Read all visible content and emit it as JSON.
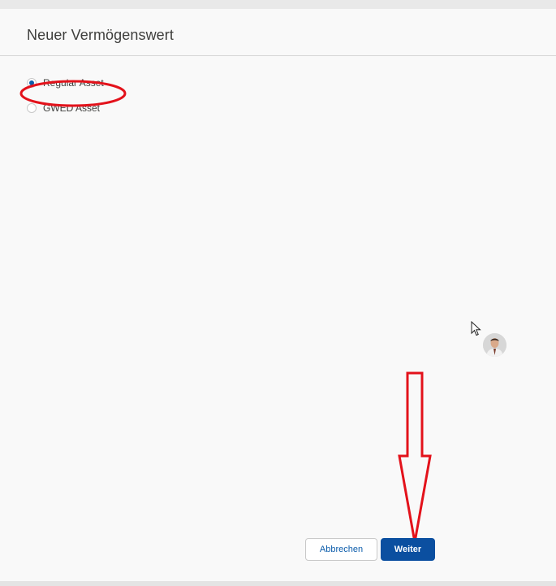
{
  "modal": {
    "title": "Neuer Vermögenswert"
  },
  "record_types": {
    "options": [
      {
        "label": "Regular Asset",
        "selected": true
      },
      {
        "label": "GWED Asset",
        "selected": false
      }
    ]
  },
  "footer": {
    "cancel_label": "Abbrechen",
    "next_label": "Weiter"
  },
  "colors": {
    "brand": "#0b4fa0",
    "annotation": "#e3121b"
  },
  "icons": {
    "cursor": "mouse-pointer-icon",
    "avatar": "user-avatar"
  }
}
